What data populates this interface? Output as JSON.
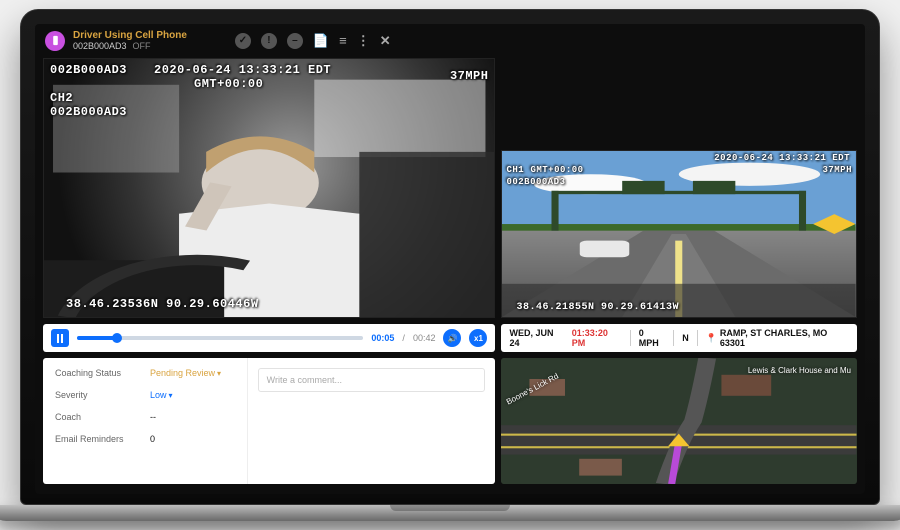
{
  "header": {
    "event_title": "Driver Using Cell Phone",
    "device_id": "002B000AD3",
    "status": "OFF"
  },
  "video_main": {
    "device": "002B000AD3",
    "timestamp": "2020-06-24 13:33:21 EDT",
    "tz": "GMT+00:00",
    "channel": "CH2",
    "device2": "002B000AD3",
    "speed": "37MPH",
    "coords": "38.46.23536N 90.29.60446W"
  },
  "video_side": {
    "timestamp": "2020-06-24 13:33:21 EDT",
    "tz": "GMT+00:00",
    "channel": "CH1",
    "device": "002B000AD3",
    "speed": "37MPH",
    "coords": "38.46.21855N 90.29.61413W"
  },
  "playback": {
    "current": "00:05",
    "sep": "/",
    "total": "00:42",
    "rate": "x1"
  },
  "infobar": {
    "date": "WED, JUN 24",
    "time": "01:33:20 PM",
    "speed": "0 MPH",
    "heading": "N",
    "location": "RAMP, ST CHARLES, MO 63301"
  },
  "coaching": {
    "status_label": "Coaching Status",
    "status_value": "Pending Review",
    "severity_label": "Severity",
    "severity_value": "Low",
    "coach_label": "Coach",
    "coach_value": "--",
    "reminders_label": "Email Reminders",
    "reminders_value": "0",
    "comment_placeholder": "Write a comment..."
  },
  "map": {
    "poi": "Lewis & Clark House and Mu",
    "road": "Boone's Lick Rd"
  }
}
